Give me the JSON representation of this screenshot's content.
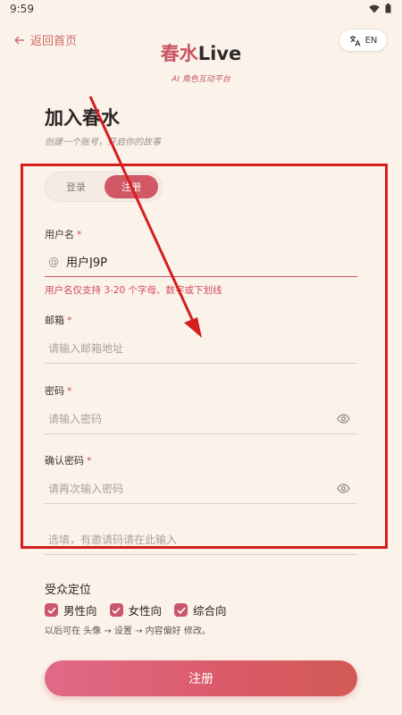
{
  "status": {
    "time": "9:59"
  },
  "nav": {
    "back_label": "返回首页",
    "lang_label": "EN"
  },
  "brand": {
    "name_cn": "春水",
    "name_en": "Live",
    "tagline": "AI 角色互动平台"
  },
  "page": {
    "title": "加入春水",
    "subtitle": "创建一个账号，开启你的故事"
  },
  "tabs": {
    "login": "登录",
    "register": "注册",
    "active": "注册"
  },
  "form": {
    "username": {
      "label": "用户名",
      "value": "用户J9P",
      "prefix": "@",
      "error": "用户名仅支持 3-20 个字母、数字或下划线"
    },
    "email": {
      "label": "邮箱",
      "placeholder": "请输入邮箱地址"
    },
    "password": {
      "label": "密码",
      "placeholder": "请输入密码"
    },
    "confirm": {
      "label": "确认密码",
      "placeholder": "请再次输入密码"
    },
    "invite": {
      "placeholder": "选填，有邀请码请在此输入"
    },
    "required_mark": "*"
  },
  "audience": {
    "label": "受众定位",
    "options": [
      {
        "label": "男性向",
        "checked": true
      },
      {
        "label": "女性向",
        "checked": true
      },
      {
        "label": "综合向",
        "checked": true
      }
    ],
    "hint": "以后可在 头像 → 设置 → 内容偏好 修改。"
  },
  "submit_label": "注册",
  "colors": {
    "accent": "#d25866",
    "background": "#fbf3ea",
    "error": "#d04b5a",
    "annotation": "#d61e1e"
  },
  "icons": {
    "back": "arrow-left-icon",
    "lang": "translate-icon",
    "eye": "eye-icon",
    "check": "checkmark-icon"
  }
}
